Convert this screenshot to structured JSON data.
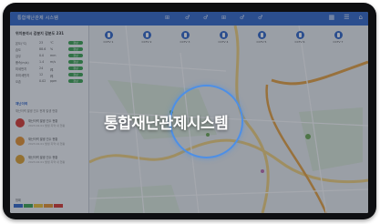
{
  "app": {
    "title": "통합재난관제시스템"
  },
  "topbar": {
    "app_name": "통합재난관제 시스템",
    "tools": [
      "⊞",
      "♂",
      "♂",
      "⊞",
      "♂",
      "♂"
    ],
    "right_icons": [
      "grid-icon",
      "list-icon",
      "user-icon"
    ]
  },
  "panel": {
    "title": "위치분석시 감분지 감분도 231",
    "rows": [
      {
        "label": "온도(℃)",
        "value": "23",
        "unit": "℃",
        "badge": "정상"
      },
      {
        "label": "습도",
        "value": "88.6",
        "unit": "%",
        "badge": "정상"
      },
      {
        "label": "강우",
        "value": "0.0",
        "unit": "mm",
        "badge": "정상"
      },
      {
        "label": "풍속(m/s)",
        "value": "1.4",
        "unit": "m/s",
        "badge": "정상"
      },
      {
        "label": "미세먼지",
        "value": "24",
        "unit": "㎍",
        "badge": "정상"
      },
      {
        "label": "초미세먼지",
        "value": "12",
        "unit": "㎍",
        "badge": "정상"
      },
      {
        "label": "오존",
        "value": "0.02",
        "unit": "ppm",
        "badge": "정상"
      }
    ],
    "section_title": "재난이력",
    "section_sub": "재난이력 발생 건수 현재 발생 현황",
    "alerts": [
      {
        "title": "재난이력 발생 건수 현황",
        "sub": "2023.02.01 발생 지역 내 현황",
        "color": "#d9342b"
      },
      {
        "title": "재난이력 발생 건수 현황",
        "sub": "2023.02.01 발생 지역 내 현황",
        "color": "#e8912a"
      },
      {
        "title": "재난이력 발생 건수 현황",
        "sub": "2023.02.01 발생 지역 내 현황",
        "color": "#e0a02a"
      }
    ],
    "legend_label": "범례",
    "legend_colors": [
      "#2d64c9",
      "#38a34d",
      "#f0c22f",
      "#e8912a",
      "#d9342b"
    ]
  },
  "map": {
    "cctv": [
      {
        "label": "CCTV 1"
      },
      {
        "label": "CCTV 2"
      },
      {
        "label": "CCTV 3"
      },
      {
        "label": "CCTV 4"
      },
      {
        "label": "CCTV 5"
      },
      {
        "label": "CCTV 6"
      },
      {
        "label": "CCTV 7"
      }
    ]
  },
  "overlay": {
    "title": "통합재난관제시스템"
  }
}
